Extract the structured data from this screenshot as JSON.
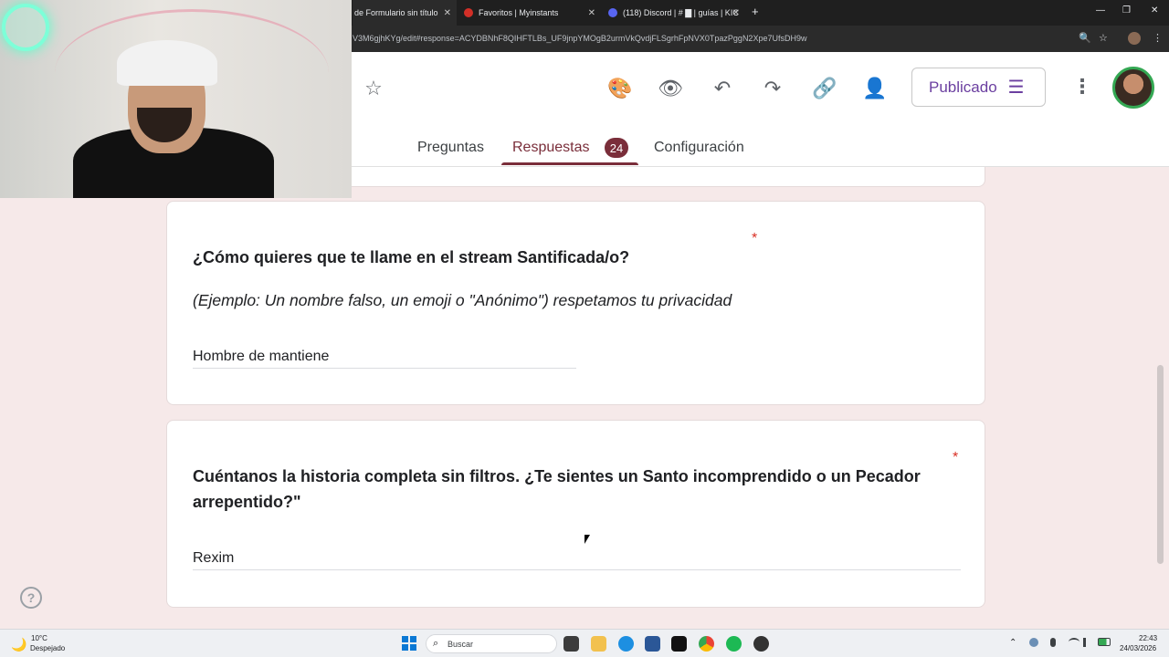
{
  "browser": {
    "tabs": [
      {
        "title": "de Formulario sin título",
        "favicon_color": "#7248b9"
      },
      {
        "title": "Favoritos | Myinstants",
        "favicon_color": "#d22f27"
      },
      {
        "title": "(118) Discord | # ▇ | guías | KIC",
        "favicon_color": "#5865f2"
      }
    ],
    "tab_close_glyph": "✕",
    "new_tab_glyph": "+",
    "window_controls": {
      "minimize": "—",
      "restore": "❐",
      "close": "✕"
    },
    "url": "V3M6gjhKYg/edit#response=ACYDBNhF8QIHFTLBs_UF9jnpYMOgB2urmVkQvdjFLSgrhFpNVX0TpazPggN2Xpe7UfsDH9w",
    "zoom_icon": "🔍",
    "bookmark_icon": "☆",
    "menu_icon": "⋮"
  },
  "header": {
    "star_icon": "☆",
    "icons": {
      "palette": "🎨",
      "preview": "👁",
      "undo": "↶",
      "redo": "↷",
      "link": "🔗",
      "add_collaborator": "👤"
    },
    "publish_label": "Publicado",
    "publish_icon": "☰",
    "more_icon": "⋮"
  },
  "nav": {
    "questions_label": "Preguntas",
    "responses_label": "Respuestas",
    "responses_count": "24",
    "settings_label": "Configuración"
  },
  "questions": [
    {
      "title": "¿Cómo quieres que te llame en el stream Santificada/o?",
      "description": "(Ejemplo: Un nombre falso, un emoji o \"Anónimo\") respetamos tu privacidad",
      "required_marker": "*",
      "answer": "Hombre de mantiene"
    },
    {
      "title_line1": "Cuéntanos la historia completa sin filtros. ¿Te sientes un Santo incomprendido o un Pecador",
      "title_line2": "arrepentido?\"",
      "required_marker": "*",
      "answer": "Rexim"
    }
  ],
  "help_label": "?",
  "taskbar": {
    "weather_icon": "🌙",
    "temperature": "10°C",
    "weather_desc": "Despejado",
    "search_icon": "⌕",
    "search_placeholder": "Buscar",
    "tray_chevron": "⌃",
    "time": "22:43",
    "date": "24/03/2026"
  }
}
